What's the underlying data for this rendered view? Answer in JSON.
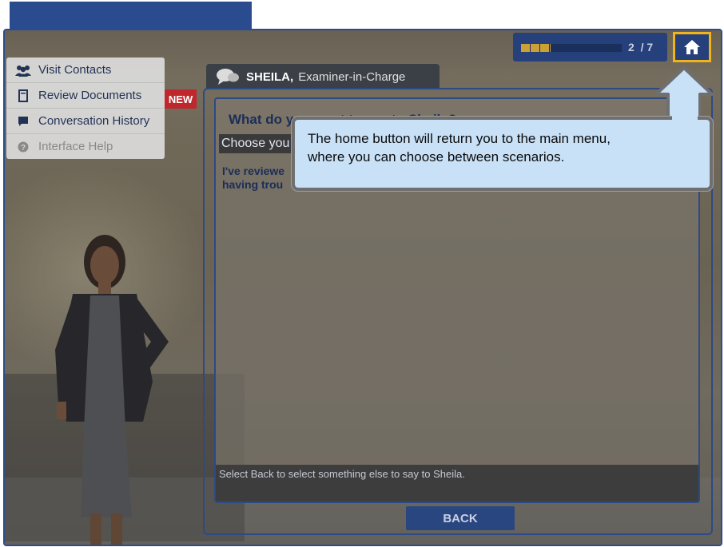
{
  "progress": {
    "current": "2",
    "total": "/ 7",
    "fraction": 0.29
  },
  "sidebar": {
    "items": [
      {
        "label": "Visit Contacts",
        "icon": "contacts-icon"
      },
      {
        "label": "Review Documents",
        "icon": "document-icon"
      },
      {
        "label": "Conversation History",
        "icon": "chat-icon"
      },
      {
        "label": "Interface Help",
        "icon": "help-icon"
      }
    ],
    "new_badge": "NEW"
  },
  "speaker": {
    "name": "SHEILA,",
    "title": "Examiner-in-Charge"
  },
  "dialog": {
    "question": "What do you want to say to Sheila?",
    "choose": "Choose you",
    "option_line1": "I've reviewe",
    "option_line2": "having trou",
    "hint": "Select Back to select something else to say to Sheila."
  },
  "back_label": "BACK",
  "callout": {
    "line1": "The home button will return you to the main menu,",
    "line2": "where you can choose between scenarios."
  },
  "colors": {
    "accent": "#2a4c8e",
    "highlight": "#f0b419",
    "badge": "#c0272d",
    "callout_bg": "#c9e1f7"
  }
}
